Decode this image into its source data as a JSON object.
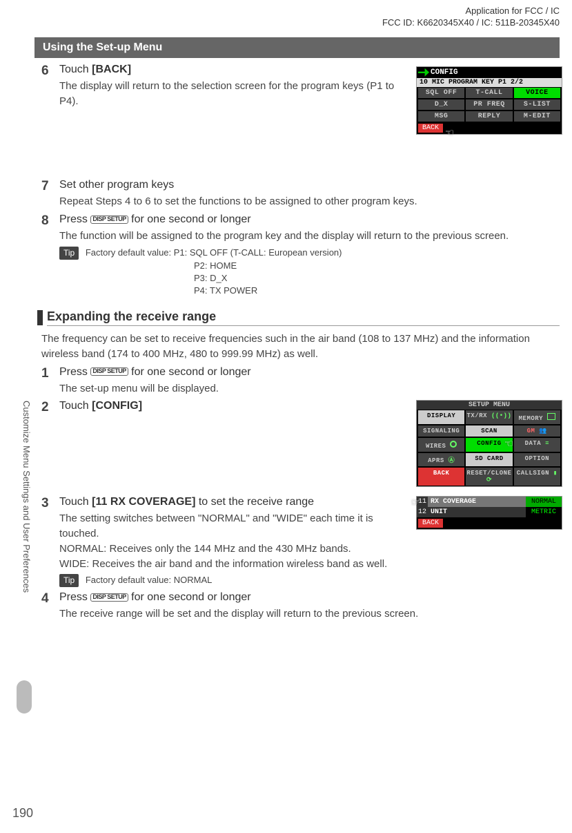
{
  "header": {
    "line1": "Application for FCC / IC",
    "line2": "FCC ID: K6620345X40 / IC: 511B-20345X40"
  },
  "banner": "Using the Set-up Menu",
  "step6": {
    "num": "6",
    "title_pre": "Touch ",
    "title_bold": "[BACK]",
    "desc": "The display will return to the selection screen for the program keys (P1 to P4)."
  },
  "step7": {
    "num": "7",
    "title": "Set other program keys",
    "desc": "Repeat Steps 4 to 6 to set the functions to be assigned to other program keys."
  },
  "step8": {
    "num": "8",
    "title_pre": "Press ",
    "key": "DISP SETUP",
    "title_post": " for one second or longer",
    "desc": "The function will be assigned to the program key and the display will return to the previous screen.",
    "tip_label": "Tip",
    "tip_l1": "Factory default value: P1: SQL OFF (T-CALL: European version)",
    "tip_l2": "P2: HOME",
    "tip_l3": "P3: D_X",
    "tip_l4": "P4: TX POWER"
  },
  "sub1": {
    "heading": "Expanding the receive range",
    "para": "The frequency can be set to receive frequencies such in the air band (108 to 137 MHz) and the information wireless band (174 to 400 MHz, 480 to 999.99 MHz) as well."
  },
  "step1": {
    "num": "1",
    "pre": "Press ",
    "key": "DISP SETUP",
    "post": " for one second or longer",
    "desc": "The set-up menu will be displayed."
  },
  "step2": {
    "num": "2",
    "pre": "Touch ",
    "bold": "[CONFIG]"
  },
  "step3": {
    "num": "3",
    "pre": "Touch ",
    "bold": "[11 RX COVERAGE]",
    "post": " to set the receive range",
    "desc": "The setting switches between \"NORMAL\" and \"WIDE\" each time it is touched.",
    "normal": "NORMAL: Receives only the 144 MHz and the 430 MHz bands.",
    "wide": "WIDE: Receives the air band and the information wireless band as well.",
    "tip_label": "Tip",
    "tip": "Factory default value: NORMAL"
  },
  "step4": {
    "num": "4",
    "pre": "Press ",
    "key": "DISP SETUP",
    "post": " for one second or longer",
    "desc": "The receive range will be set and the display will return to the previous screen."
  },
  "side_text": "Customize Menu Settings and User Preferences",
  "page_number": "190",
  "mock1": {
    "title": "CONFIG",
    "header_row": "10  MIC PROGRAM KEY P1 2/2",
    "r1": [
      "SQL OFF",
      "T-CALL",
      "VOICE"
    ],
    "r2": [
      "D_X",
      "PR FREQ",
      "S-LIST"
    ],
    "r3": [
      "MSG",
      "REPLY",
      "M-EDIT"
    ],
    "back": "BACK"
  },
  "mock2": {
    "title": "SETUP MENU",
    "r1": [
      "DISPLAY",
      "TX/RX",
      "MEMORY"
    ],
    "r2": [
      "SIGNALING",
      "SCAN",
      ""
    ],
    "r3": [
      "WIRES",
      "CONFIG",
      "DATA"
    ],
    "r4": [
      "APRS",
      "SD CARD",
      "OPTION"
    ],
    "r5b": "RESET/CLONE",
    "r5c": "CALLSIGN",
    "back": "BACK"
  },
  "mock3": {
    "r1": {
      "idx": "11",
      "lbl": "RX COVERAGE",
      "val": "NORMAL"
    },
    "r2": {
      "idx": "12",
      "lbl": "UNIT",
      "val": "METRIC"
    },
    "back": "BACK"
  }
}
